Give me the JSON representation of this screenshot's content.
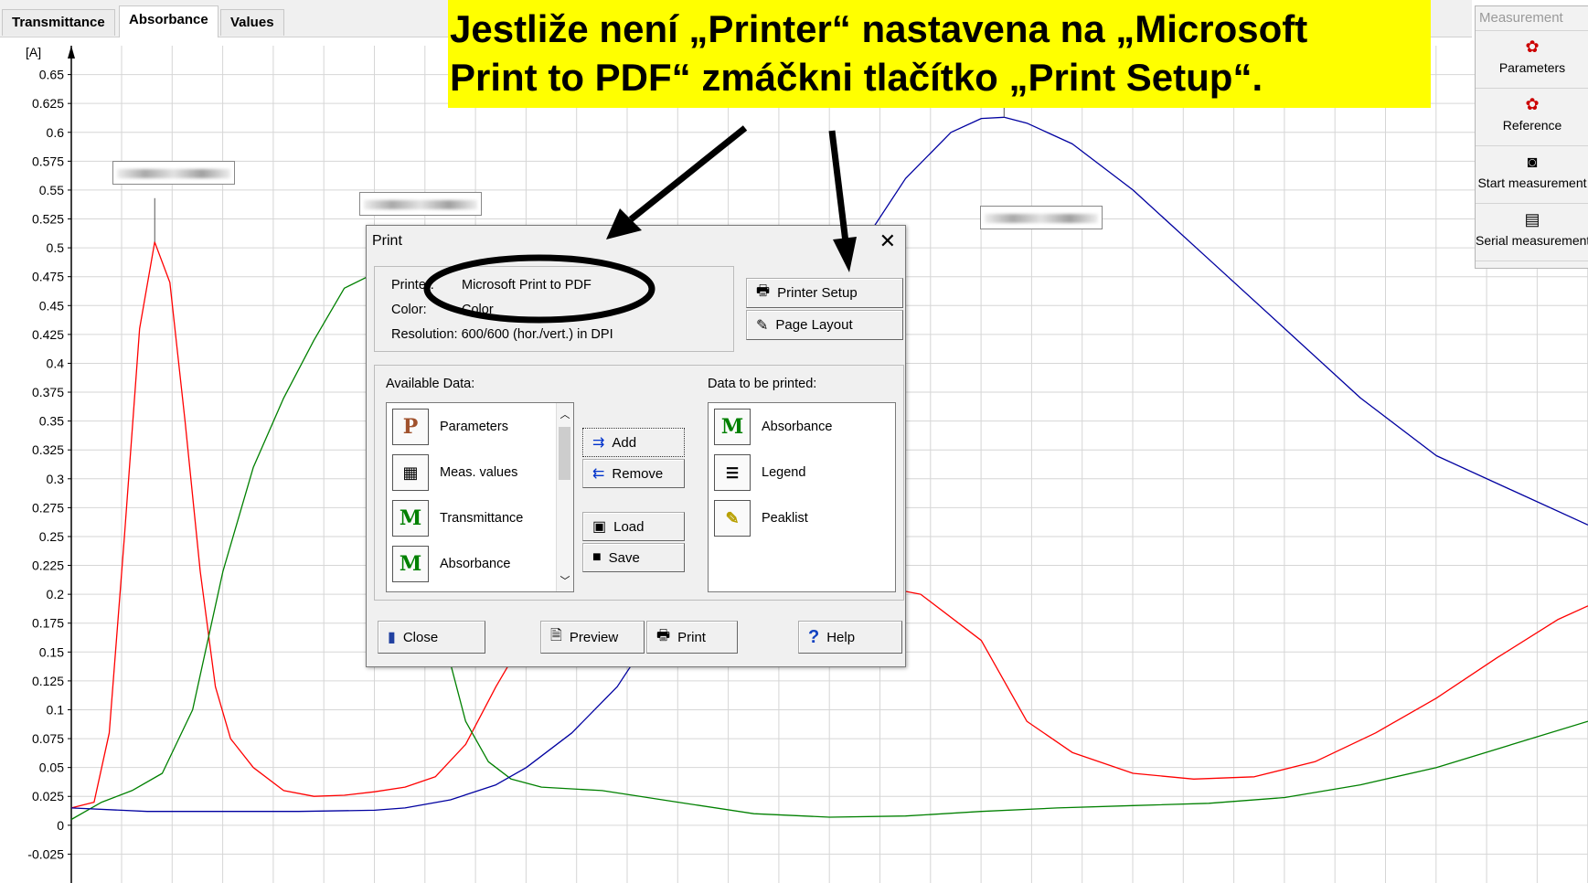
{
  "tabs": [
    {
      "label": "Transmittance",
      "active": false
    },
    {
      "label": "Absorbance",
      "active": true
    },
    {
      "label": "Values",
      "active": false
    }
  ],
  "annotation": {
    "line1": "Jestliže není „Printer“ nastavena na „Microsoft",
    "line2": "Print to PDF“ zmáčkni tlačítko „Print Setup“.",
    "background": "#ffff00"
  },
  "measurement_panel": {
    "title": "Measurement",
    "buttons": [
      {
        "label": "Parameters",
        "icon": "parameters-icon"
      },
      {
        "label": "Reference",
        "icon": "reference-icon"
      },
      {
        "label": "Start measurement",
        "icon": "camera-icon"
      },
      {
        "label": "Serial measurement",
        "icon": "stack-icon"
      }
    ]
  },
  "print_dialog": {
    "title": "Print",
    "printer_label": "Printer:",
    "printer_value": "Microsoft Print to PDF",
    "color_label": "Color:",
    "color_value": "Color",
    "resolution": "Resolution: 600/600 (hor./vert.) in DPI",
    "printer_setup_button": "Printer Setup",
    "page_layout_button": "Page Layout",
    "available_data_label": "Available Data:",
    "available_data": [
      "Parameters",
      "Meas. values",
      "Transmittance",
      "Absorbance"
    ],
    "data_to_print_label": "Data to be printed:",
    "data_to_print": [
      "Absorbance",
      "Legend",
      "Peaklist"
    ],
    "add_button": "Add",
    "remove_button": "Remove",
    "load_button": "Load",
    "save_button": "Save",
    "close_button": "Close",
    "preview_button": "Preview",
    "print_button": "Print",
    "help_button": "Help"
  },
  "chart_data": {
    "type": "line",
    "ylabel": "[A]",
    "ylim": [
      -0.05,
      0.675
    ],
    "yticks": [
      0.65,
      0.625,
      0.6,
      0.575,
      0.55,
      0.525,
      0.5,
      0.475,
      0.45,
      0.425,
      0.4,
      0.375,
      0.35,
      0.325,
      0.3,
      0.275,
      0.25,
      0.225,
      0.2,
      0.175,
      0.15,
      0.125,
      0.1,
      0.075,
      0.05,
      0.025,
      0,
      -0.025
    ],
    "ytick_labels": [
      "0.65",
      "0.625",
      "0.6",
      "0.575",
      "0.55",
      "0.525",
      "0.5",
      "0.475",
      "0.45",
      "0.425",
      "0.4",
      "0.375",
      "0.35",
      "0.325",
      "0.3",
      "0.275",
      "0.25",
      "0.225",
      "0.2",
      "0.175",
      "0.15",
      "0.125",
      "0.1",
      "0.075",
      "0.05",
      "0.025",
      "0",
      "-0.025"
    ],
    "xlim": [
      0,
      100
    ],
    "grid": true,
    "series": [
      {
        "color": "#ff0000",
        "x": [
          0,
          1.5,
          2.5,
          3.5,
          4.5,
          5.5,
          6.5,
          7.5,
          8.5,
          9.5,
          10.5,
          12,
          14,
          16,
          18,
          20,
          22,
          24,
          26,
          28,
          30,
          32,
          33,
          36,
          40,
          44,
          48,
          52,
          56,
          60,
          63,
          66,
          70,
          74,
          78,
          82,
          86,
          90,
          94,
          98,
          100
        ],
        "y": [
          0.015,
          0.02,
          0.08,
          0.25,
          0.43,
          0.505,
          0.47,
          0.35,
          0.22,
          0.12,
          0.075,
          0.05,
          0.03,
          0.025,
          0.026,
          0.029,
          0.033,
          0.042,
          0.07,
          0.12,
          0.165,
          0.195,
          0.2,
          0.21,
          0.22,
          0.22,
          0.215,
          0.21,
          0.2,
          0.16,
          0.09,
          0.063,
          0.045,
          0.04,
          0.042,
          0.055,
          0.08,
          0.11,
          0.145,
          0.178,
          0.19
        ]
      },
      {
        "color": "#008000",
        "x": [
          0,
          2,
          4,
          6,
          8,
          10,
          12,
          14,
          16,
          18,
          20,
          21.5,
          22.3,
          23,
          24,
          26,
          27.5,
          29,
          31,
          35,
          40,
          45,
          50,
          55,
          60,
          65,
          70,
          75,
          80,
          85,
          90,
          95,
          100
        ],
        "y": [
          0.005,
          0.02,
          0.03,
          0.045,
          0.1,
          0.22,
          0.31,
          0.37,
          0.42,
          0.465,
          0.478,
          0.45,
          0.38,
          0.29,
          0.19,
          0.09,
          0.055,
          0.04,
          0.033,
          0.03,
          0.02,
          0.01,
          0.007,
          0.008,
          0.012,
          0.015,
          0.017,
          0.019,
          0.024,
          0.035,
          0.05,
          0.07,
          0.09
        ]
      },
      {
        "color": "#0000a0",
        "x": [
          0,
          5,
          10,
          15,
          20,
          22,
          25,
          28,
          30,
          33,
          36,
          40,
          44,
          48,
          52,
          55,
          58,
          60,
          61.5,
          63,
          66,
          70,
          75,
          80,
          85,
          90,
          95,
          100
        ],
        "y": [
          0.015,
          0.012,
          0.012,
          0.012,
          0.013,
          0.015,
          0.022,
          0.035,
          0.05,
          0.08,
          0.12,
          0.2,
          0.3,
          0.4,
          0.5,
          0.56,
          0.6,
          0.612,
          0.613,
          0.608,
          0.59,
          0.55,
          0.49,
          0.43,
          0.37,
          0.32,
          0.29,
          0.26
        ]
      }
    ]
  }
}
